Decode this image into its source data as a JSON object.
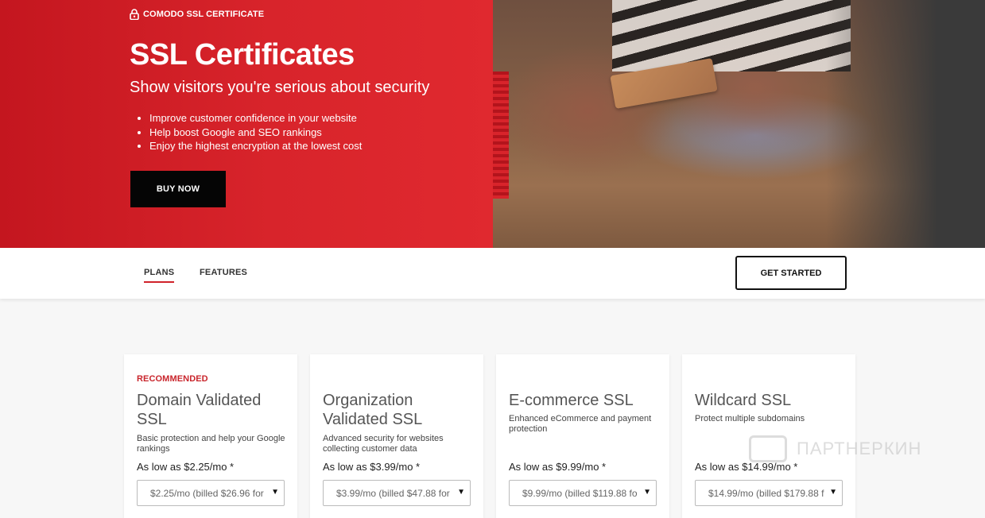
{
  "hero": {
    "brand": "COMODO SSL CERTIFICATE",
    "title": "SSL Certificates",
    "subtitle": "Show visitors you're serious about security",
    "bullets": [
      "Improve customer confidence in your website",
      "Help boost Google and SEO rankings",
      "Enjoy the highest encryption at the lowest cost"
    ],
    "buy_label": "BUY NOW"
  },
  "nav": {
    "tabs": [
      {
        "label": "PLANS",
        "active": true
      },
      {
        "label": "FEATURES",
        "active": false
      }
    ],
    "cta_label": "GET STARTED"
  },
  "plans": [
    {
      "badge": "RECOMMENDED",
      "name": "Domain Validated SSL",
      "description": "Basic protection and help your Google rankings",
      "price": "As low as $2.25/mo *",
      "term": "$2.25/mo (billed $26.96 for"
    },
    {
      "badge": "",
      "name": "Organization Validated SSL",
      "description": "Advanced security for websites collecting customer data",
      "price": "As low as $3.99/mo *",
      "term": "$3.99/mo (billed $47.88 for"
    },
    {
      "badge": "",
      "name": "E-commerce SSL",
      "description": "Enhanced eCommerce and payment protection",
      "price": "As low as $9.99/mo *",
      "term": "$9.99/mo (billed $119.88 fo"
    },
    {
      "badge": "",
      "name": "Wildcard SSL",
      "description": "Protect multiple subdomains",
      "price": "As low as $14.99/mo *",
      "term": "$14.99/mo (billed $179.88 f"
    }
  ],
  "watermark": "ПАРТНЕРКИН",
  "colors": {
    "brand_red": "#d8242b",
    "accent": "#c9252c",
    "dark": "#050505"
  }
}
